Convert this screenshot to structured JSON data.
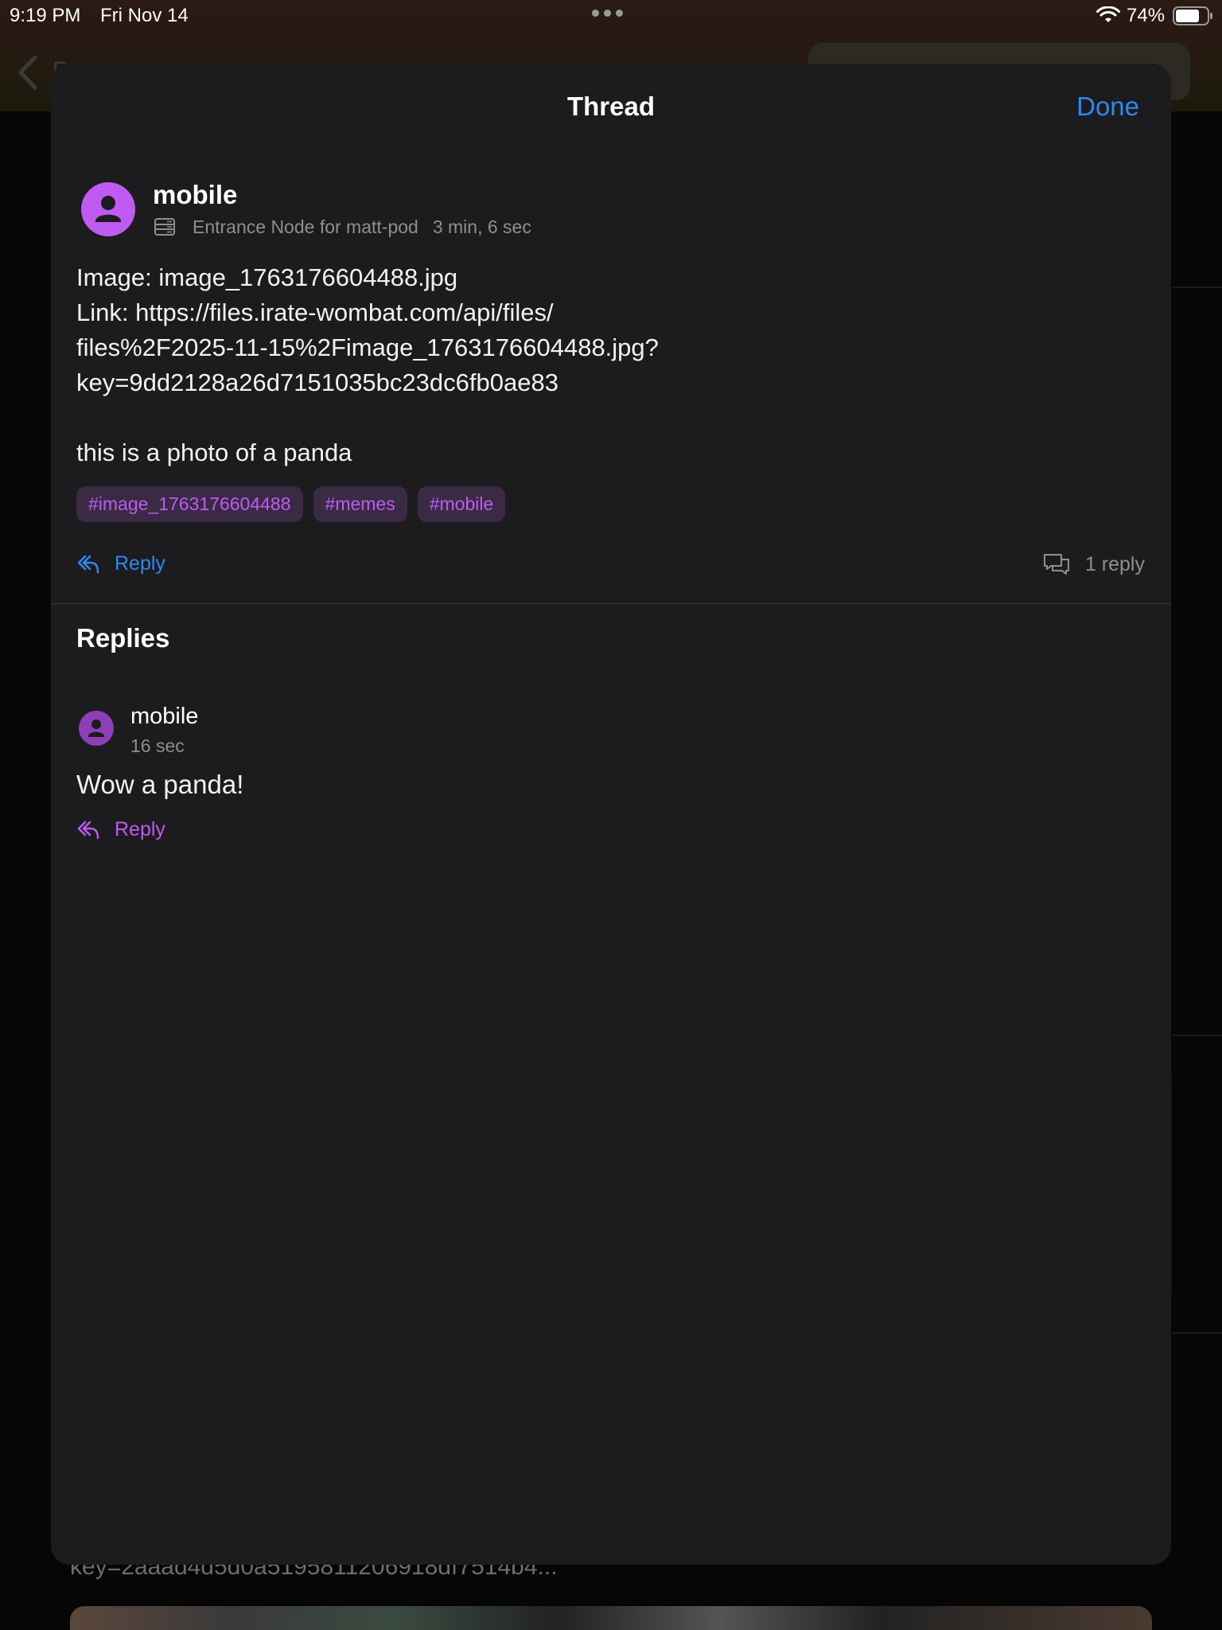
{
  "status_bar": {
    "time": "9:19 PM",
    "date": "Fri Nov 14",
    "battery_percent": "74%"
  },
  "background": {
    "back_label": "Do",
    "truncated_text": "key=2aaad4d5d0a5195811206918df7514b4..."
  },
  "sheet": {
    "title": "Thread",
    "done_label": "Done"
  },
  "post": {
    "author": "mobile",
    "node": "Entrance Node for matt-pod",
    "time": "3 min, 6 sec",
    "body_lines": [
      "Image: image_1763176604488.jpg",
      "Link: https://files.irate-wombat.com/api/files/",
      "files%2F2025-11-15%2Fimage_1763176604488.jpg?",
      "key=9dd2128a26d7151035bc23dc6fb0ae83"
    ],
    "caption": "this is a photo of a panda",
    "tags": [
      "#image_1763176604488",
      "#memes",
      "#mobile"
    ],
    "reply_label": "Reply",
    "reply_count": "1 reply"
  },
  "replies": {
    "heading": "Replies",
    "items": [
      {
        "author": "mobile",
        "time": "16 sec",
        "body": "Wow a panda!",
        "reply_label": "Reply"
      }
    ]
  },
  "colors": {
    "accent_blue": "#2f88f0",
    "accent_purple": "#bf5af2",
    "sheet_bg": "#1c1c1e",
    "muted_text": "#8e8e93"
  },
  "icons": {
    "avatar": "person-icon",
    "server": "server-icon",
    "reply": "reply-arrow-icon",
    "replies": "chat-bubbles-icon",
    "wifi": "wifi-icon",
    "battery": "battery-icon"
  }
}
